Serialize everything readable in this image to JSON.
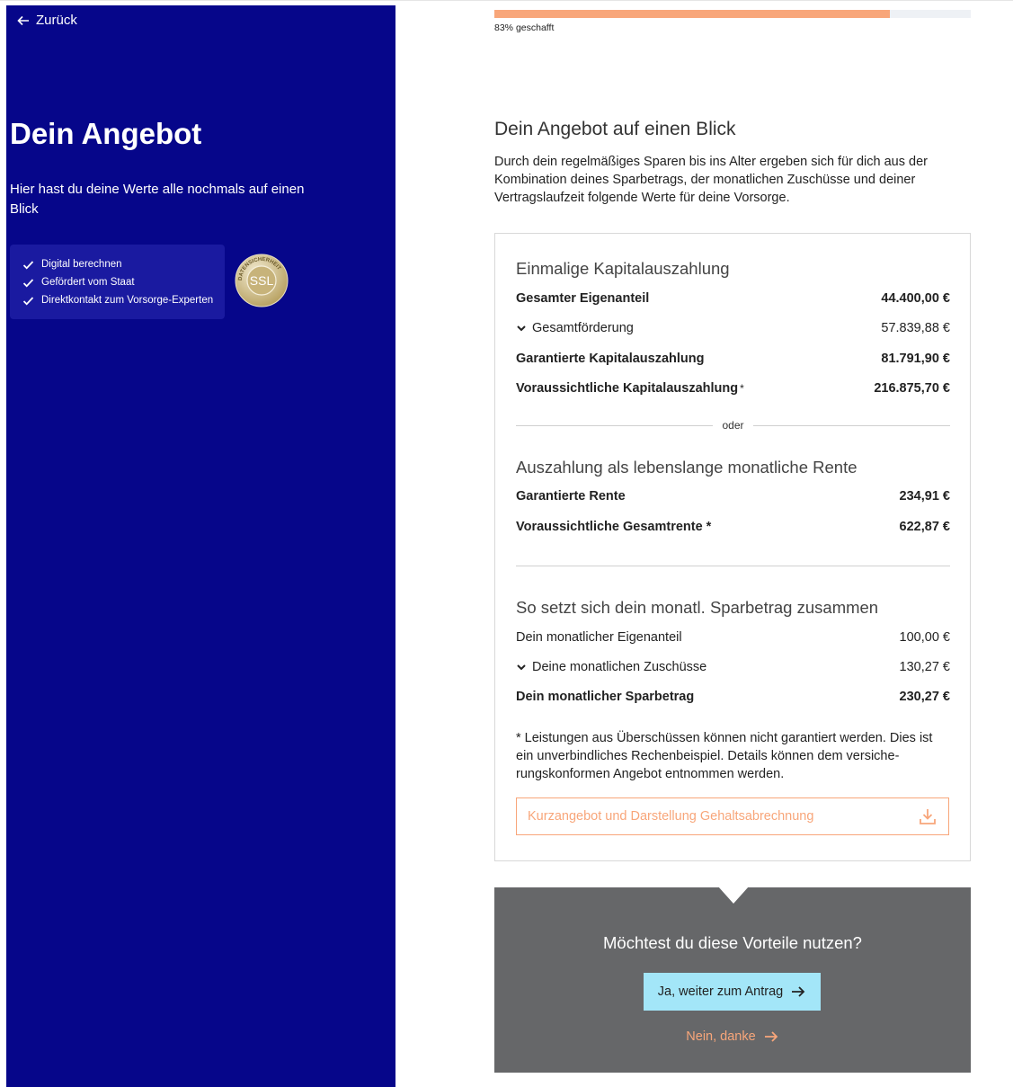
{
  "left": {
    "back_label": "Zurück",
    "title": "Dein Angebot",
    "subtitle": "Hier hast du deine Werte alle nochmals auf einen Blick",
    "features": [
      "Digital berechnen",
      "Gefördert vom Staat",
      "Direktkontakt zum Vorsorge-Experten"
    ],
    "badge": {
      "ring_text": "DATENSICHERHEIT",
      "label": "SSL"
    }
  },
  "progress": {
    "percent": 83,
    "percent_text": "83%",
    "label": "geschafft"
  },
  "main": {
    "title": "Dein Angebot auf einen Blick",
    "intro": "Durch dein regelmäßiges Sparen bis ins Alter ergeben sich für dich aus der Kombination deines Sparbetrags, der monatlichen Zuschüsse und deiner Vertragslaufzeit folgende Werte für deine Vorsorge."
  },
  "capital": {
    "title": "Einmalige Kapitalauszahlung",
    "rows": [
      {
        "label": "Gesamter Eigenanteil",
        "value": "44.400,00 €"
      },
      {
        "label": "Gesamtförderung",
        "value": "57.839,88 €"
      },
      {
        "label": "Garantierte Kapitalauszahlung",
        "value": "81.791,90 €"
      },
      {
        "label": "Voraussichtliche Kapitalauszahlung",
        "suffix": " *",
        "value": "216.875,70 €"
      }
    ]
  },
  "divider_label": "oder",
  "pension": {
    "title": "Auszahlung als lebenslange monatliche Rente",
    "rows": [
      {
        "label": "Garantierte Rente",
        "value": "234,91 €"
      },
      {
        "label": "Voraussichtliche Gesamtrente *",
        "value": "622,87 €"
      }
    ]
  },
  "savings": {
    "title": "So setzt sich dein monatl. Sparbetrag zusammen",
    "rows": [
      {
        "label": "Dein monatlicher Eigenanteil",
        "value": "100,00 €"
      },
      {
        "label": "Deine monatlichen Zuschüsse",
        "value": "130,27 €"
      },
      {
        "label": "Dein monatlicher Sparbetrag",
        "value": "230,27 €"
      }
    ]
  },
  "footnote": "* Leistungen aus Überschüssen können nicht garantiert werden. Dies ist ein unverbindliches Rechenbeispiel. Details können dem versiche­rungskonformen Angebot entnommen werden.",
  "download_label": "Kurzangebot und Darstellung Gehaltsabrechnung",
  "cta": {
    "question": "Möchtest du diese Vorteile nutzen?",
    "yes_label": "Ja, weiter zum Antrag",
    "no_label": "Nein, danke"
  },
  "colors": {
    "left_bg": "#06068a",
    "accent_orange": "#f8a67a",
    "cta_bg": "#666769",
    "yes_button": "#a3e6f8"
  },
  "icons": [
    "arrow-left-icon",
    "check-icon",
    "ssl-seal-icon",
    "chevron-down-icon",
    "download-icon",
    "arrow-right-icon"
  ]
}
